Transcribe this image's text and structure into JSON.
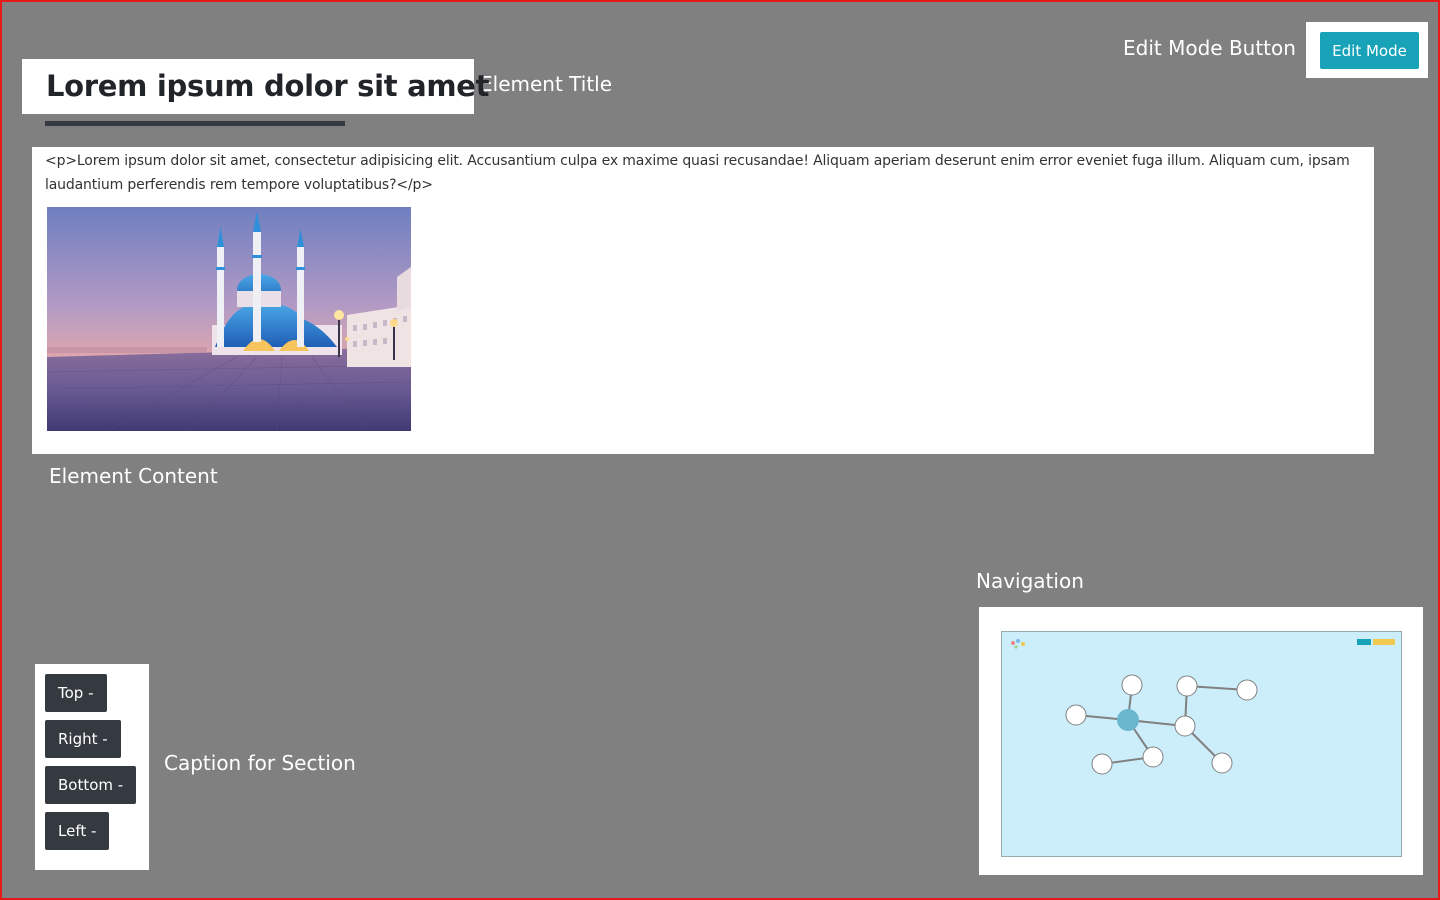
{
  "annotations": {
    "edit_mode_button": "Edit Mode Button",
    "element_title": "Element Title",
    "element_content": "Element Content",
    "navigation": "Navigation",
    "caption_for_section": "Caption for Section"
  },
  "toolbar": {
    "edit_mode_label": "Edit Mode"
  },
  "element": {
    "title": "Lorem ipsum dolor sit amet",
    "content_text": "<p>Lorem ipsum dolor sit amet, consectetur adipisicing elit. Accusantium culpa ex maxime quasi recusandae! Aliquam aperiam deserunt enim error eveniet fuga illum. Aliquam cum, ipsam laudantium perferendis rem tempore voluptatibus?</p>",
    "image_subject": "mosque-at-sunset"
  },
  "position_buttons": [
    {
      "label": "Top -"
    },
    {
      "label": "Right -"
    },
    {
      "label": "Bottom -"
    },
    {
      "label": "Left -"
    }
  ],
  "navigation": {
    "active_node_color": "#6ab6cc",
    "node_color": "#ffffff",
    "map_background": "#cceefb"
  },
  "colors": {
    "background": "#808080",
    "frame": "#e5181b",
    "edit_button": "#17a2b8",
    "dark_button": "#343a40"
  }
}
